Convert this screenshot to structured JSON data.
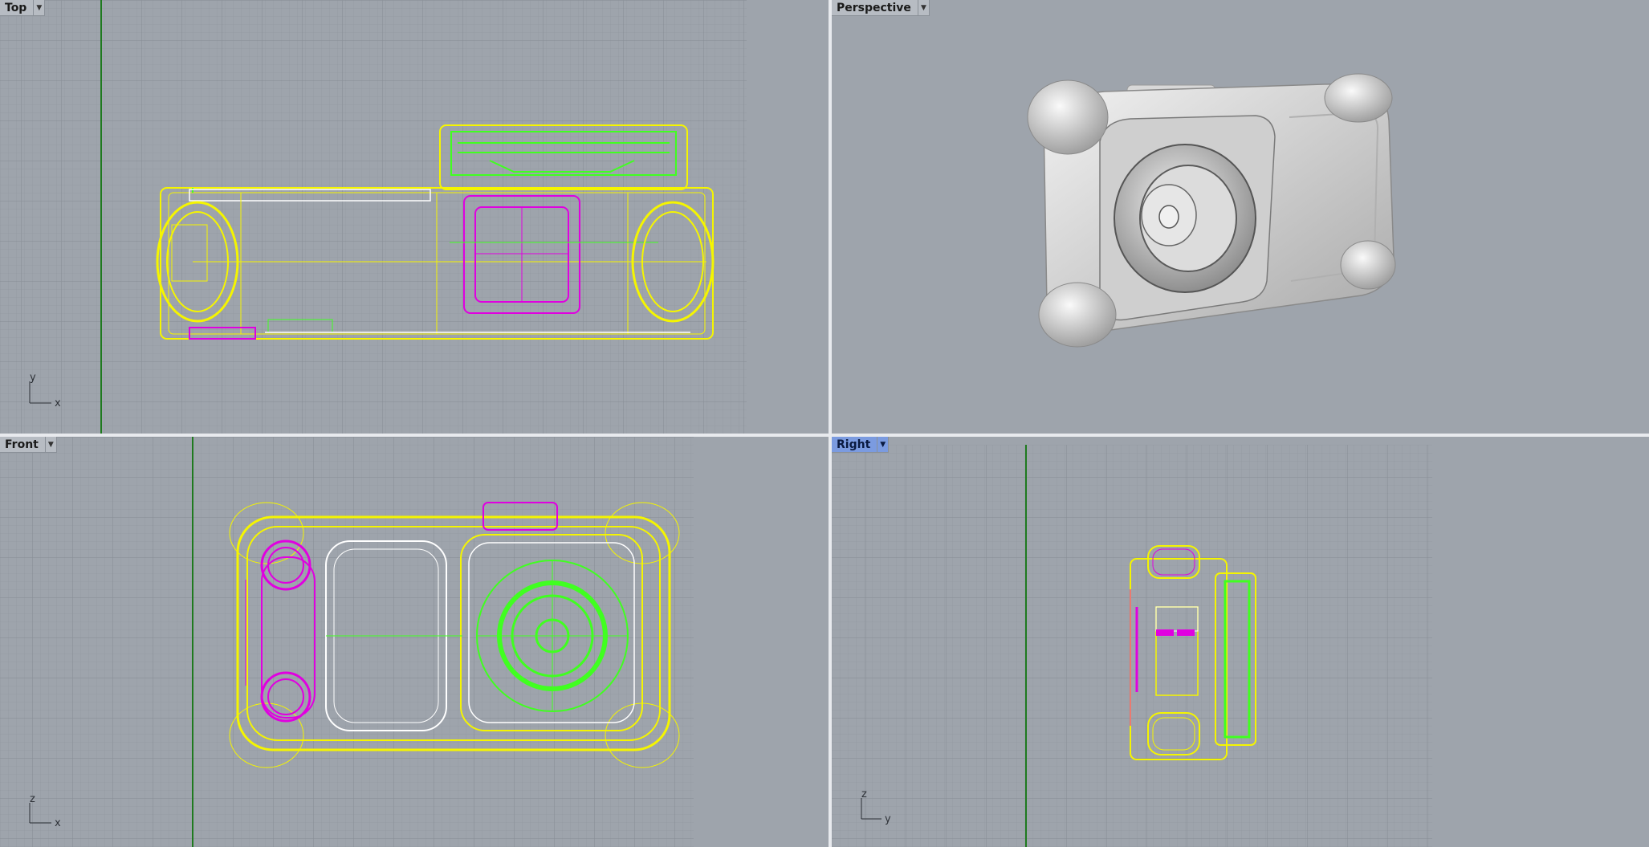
{
  "viewports": {
    "top": {
      "title": "Top",
      "axis_h": "x",
      "axis_v": "y"
    },
    "perspective": {
      "title": "Perspective"
    },
    "front": {
      "title": "Front",
      "axis_h": "x",
      "axis_v": "z"
    },
    "right": {
      "title": "Right",
      "axis_h": "y",
      "axis_v": "z",
      "active": true
    }
  },
  "menu_icon": "chevron-down-icon",
  "colors": {
    "viewport_bg": "#9ea4ac",
    "grid_minor": "#959ba3",
    "grid_major": "#878d95",
    "axis_green": "#1f7a1f",
    "wire_yellow": "#f5f500",
    "wire_magenta": "#e000e0",
    "wire_green": "#40ff20",
    "wire_white": "#ffffff",
    "active_label": "#7b9be0"
  }
}
